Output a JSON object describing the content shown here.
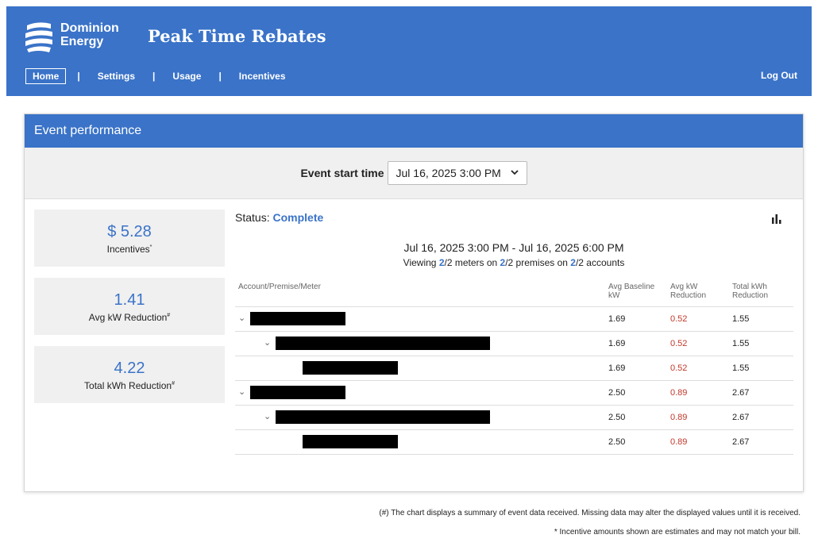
{
  "brand": {
    "line1": "Dominion",
    "line2": "Energy"
  },
  "app_title": "Peak Time Rebates",
  "nav": {
    "home": "Home",
    "settings": "Settings",
    "usage": "Usage",
    "incentives": "Incentives",
    "sep": "|",
    "logout": "Log Out"
  },
  "card": {
    "title": "Event performance",
    "filter_label": "Event start time",
    "filter_value": "Jul 16, 2025 3:00 PM"
  },
  "stats": [
    {
      "value": "$ 5.28",
      "label": "Incentives",
      "mark": "*"
    },
    {
      "value": "1.41",
      "label": "Avg kW Reduction",
      "mark": "#"
    },
    {
      "value": "4.22",
      "label": "Total kWh Reduction",
      "mark": "#"
    }
  ],
  "status": {
    "label": "Status:",
    "value": "Complete"
  },
  "range": "Jul 16, 2025 3:00 PM - Jul 16, 2025 6:00 PM",
  "viewing": {
    "p1": "Viewing ",
    "n1": "2",
    "p2": "/2 meters on ",
    "n2": "2",
    "p3": "/2 premises on ",
    "n3": "2",
    "p4": "/2 accounts"
  },
  "table": {
    "headers": [
      "Account/Premise/Meter",
      "Avg Baseline kW",
      "Avg kW Reduction",
      "Total kWh Reduction"
    ],
    "rows": [
      {
        "baseline": "1.69",
        "reduction": "0.52",
        "total": "1.55"
      },
      {
        "baseline": "1.69",
        "reduction": "0.52",
        "total": "1.55"
      },
      {
        "baseline": "1.69",
        "reduction": "0.52",
        "total": "1.55"
      },
      {
        "baseline": "2.50",
        "reduction": "0.89",
        "total": "2.67"
      },
      {
        "baseline": "2.50",
        "reduction": "0.89",
        "total": "2.67"
      },
      {
        "baseline": "2.50",
        "reduction": "0.89",
        "total": "2.67"
      }
    ]
  },
  "footnotes": {
    "hash": "(#) The chart displays a summary of event data received. Missing data may alter the displayed values until it is received.",
    "star": "* Incentive amounts shown are estimates and may not match your bill."
  },
  "colors": {
    "brand_blue": "#3a73c8",
    "reduction_red": "#c0392b"
  },
  "icons": [
    "dominion-logo-icon",
    "chevron-down-icon",
    "bar-chart-icon",
    "caret-icon"
  ]
}
